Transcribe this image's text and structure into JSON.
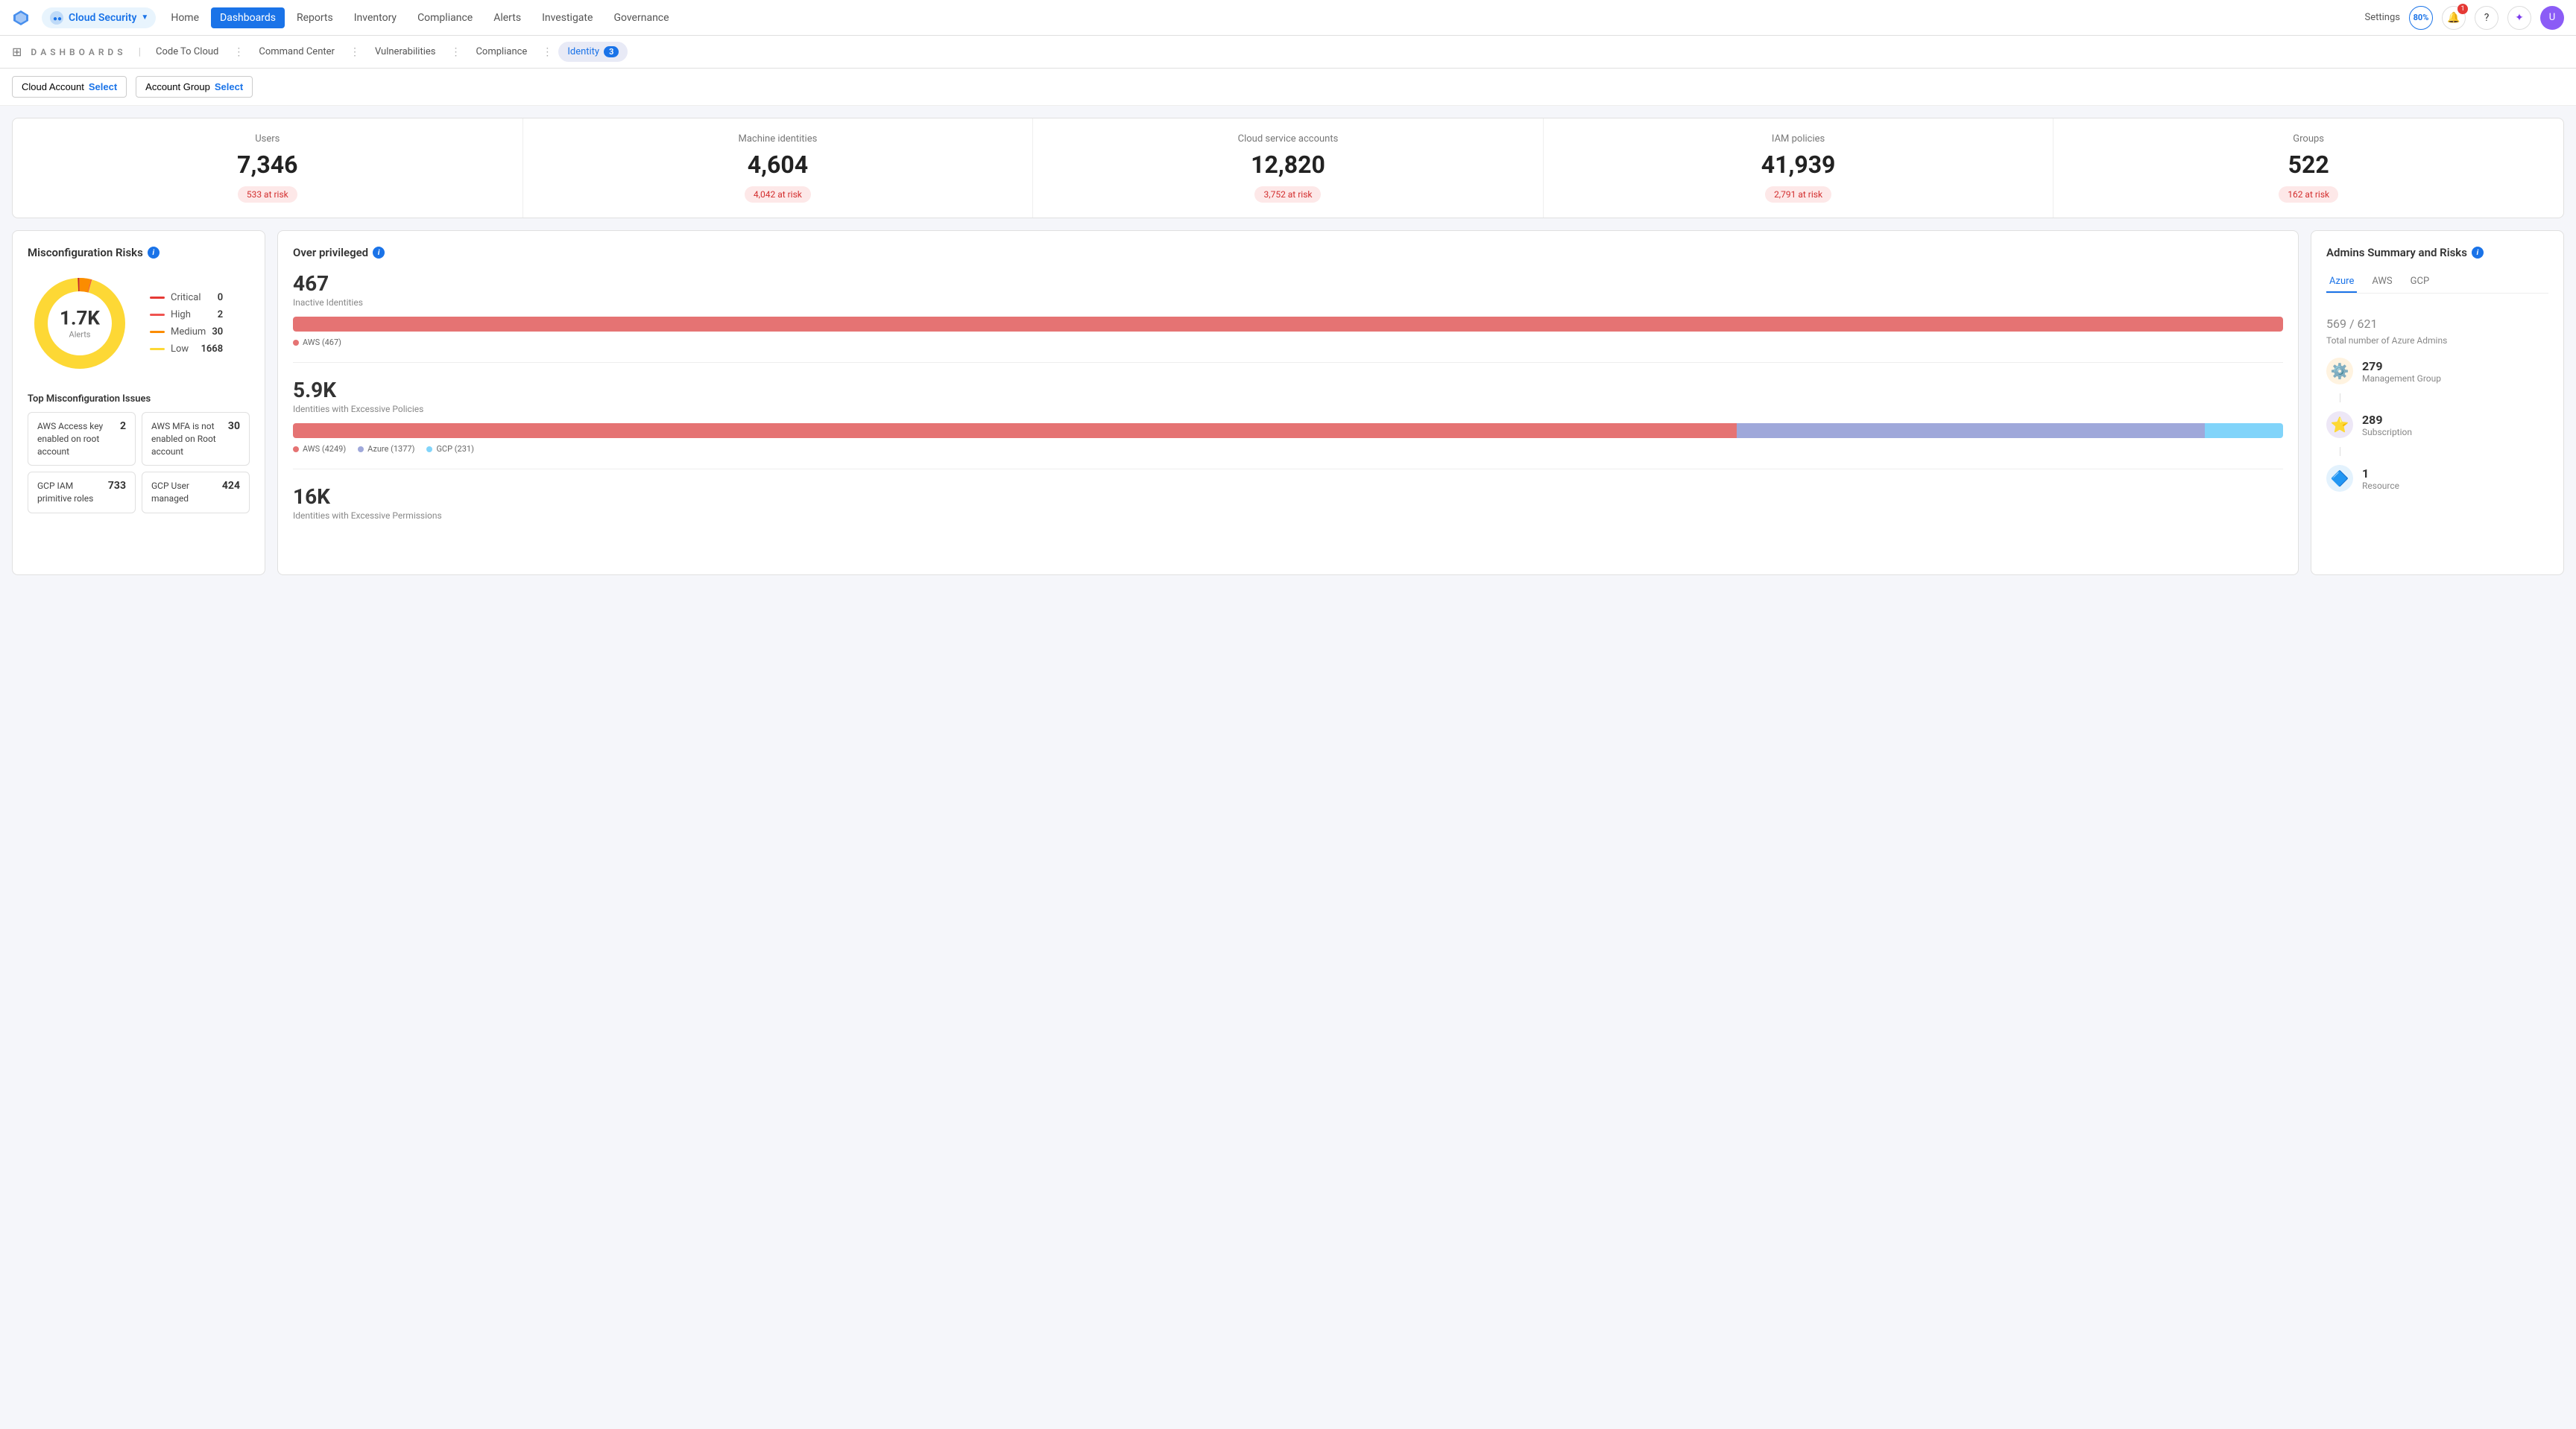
{
  "nav": {
    "logo_text": "Cloud Security",
    "items": [
      {
        "label": "Home",
        "active": false
      },
      {
        "label": "Dashboards",
        "active": true
      },
      {
        "label": "Reports",
        "active": false
      },
      {
        "label": "Inventory",
        "active": false
      },
      {
        "label": "Compliance",
        "active": false
      },
      {
        "label": "Alerts",
        "active": false
      },
      {
        "label": "Investigate",
        "active": false
      },
      {
        "label": "Governance",
        "active": false
      }
    ],
    "settings_label": "Settings",
    "avatar_text": "U"
  },
  "tabs_bar": {
    "section_label": "D A S H B O A R D S",
    "tabs": [
      {
        "label": "Code To Cloud",
        "active": false,
        "badge": null
      },
      {
        "label": "Command Center",
        "active": false,
        "badge": null
      },
      {
        "label": "Vulnerabilities",
        "active": false,
        "badge": null
      },
      {
        "label": "Compliance",
        "active": false,
        "badge": null
      },
      {
        "label": "Identity",
        "active": true,
        "badge": "3"
      }
    ]
  },
  "filters": {
    "cloud_account_label": "Cloud Account",
    "cloud_account_select": "Select",
    "account_group_label": "Account Group",
    "account_group_select": "Select"
  },
  "summary_cards": [
    {
      "label": "Users",
      "value": "7,346",
      "risk": "533 at risk"
    },
    {
      "label": "Machine identities",
      "value": "4,604",
      "risk": "4,042 at risk"
    },
    {
      "label": "Cloud service accounts",
      "value": "12,820",
      "risk": "3,752 at risk"
    },
    {
      "label": "IAM policies",
      "value": "41,939",
      "risk": "2,791 at risk"
    },
    {
      "label": "Groups",
      "value": "522",
      "risk": "162 at risk"
    }
  ],
  "misconfig": {
    "title": "Misconfiguration Risks",
    "donut": {
      "value": "1.7K",
      "sublabel": "Alerts",
      "segments": [
        {
          "label": "Critical",
          "color": "#e53935",
          "count": "0",
          "dash": "0,880"
        },
        {
          "label": "High",
          "color": "#ef5350",
          "count": "2",
          "dash": "4,876"
        },
        {
          "label": "Medium",
          "color": "#fb8c00",
          "count": "30",
          "dash": "66,810"
        },
        {
          "label": "Low",
          "color": "#fdd835",
          "count": "1668",
          "dash": "800,76"
        }
      ]
    },
    "issues_title": "Top Misconfiguration Issues",
    "issues": [
      {
        "text": "AWS Access key enabled on root account",
        "count": "2"
      },
      {
        "text": "AWS MFA is not enabled on Root account",
        "count": "30"
      },
      {
        "text": "GCP IAM primitive roles",
        "count": "733"
      },
      {
        "text": "GCP User managed",
        "count": "424"
      }
    ]
  },
  "overprivileged": {
    "title": "Over privileged",
    "sections": [
      {
        "count": "467",
        "label": "Inactive Identities",
        "bars": [
          {
            "label": "AWS (467)",
            "color": "#e57373",
            "pct": 100,
            "flex": 1
          }
        ],
        "legend": [
          {
            "label": "AWS (467)",
            "color": "#e57373"
          }
        ]
      },
      {
        "count": "5.9K",
        "label": "Identities with Excessive Policies",
        "bars": [
          {
            "label": "AWS (4249)",
            "color": "#e57373",
            "flex": 4249
          },
          {
            "label": "Azure (1377)",
            "color": "#9fa8da",
            "flex": 1377
          },
          {
            "label": "GCP (231)",
            "color": "#81d4fa",
            "flex": 231
          }
        ],
        "legend": [
          {
            "label": "AWS (4249)",
            "color": "#e57373"
          },
          {
            "label": "Azure (1377)",
            "color": "#9fa8da"
          },
          {
            "label": "GCP (231)",
            "color": "#81d4fa"
          }
        ]
      },
      {
        "count": "16K",
        "label": "Identities with Excessive Permissions",
        "bars": [],
        "legend": []
      }
    ]
  },
  "admins": {
    "title": "Admins Summary and Risks",
    "tabs": [
      "Azure",
      "AWS",
      "GCP"
    ],
    "active_tab": "Azure",
    "total": "569",
    "total_of": "621",
    "total_label": "Total number of Azure Admins",
    "items": [
      {
        "icon": "⚙️",
        "icon_bg": "#fff3e0",
        "count": "279",
        "type": "Management Group"
      },
      {
        "icon": "⭐",
        "icon_bg": "#ede7f6",
        "count": "289",
        "type": "Subscription"
      },
      {
        "icon": "🔷",
        "icon_bg": "#e3f2fd",
        "count": "1",
        "type": "Resource"
      }
    ]
  }
}
